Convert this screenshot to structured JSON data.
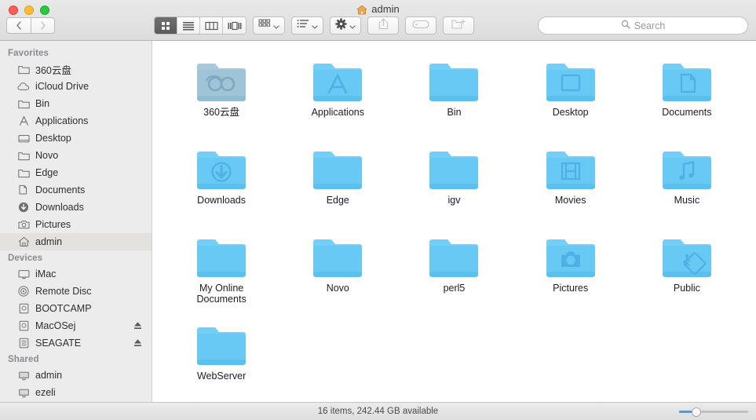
{
  "window": {
    "title": "admin",
    "title_icon": "home-icon",
    "traffic_lights": [
      {
        "name": "close-button",
        "color": "#ff5f57"
      },
      {
        "name": "minimize-button",
        "color": "#ffbd2e"
      },
      {
        "name": "maximize-button",
        "color": "#28c940"
      }
    ]
  },
  "nav": {
    "back_label": "Back",
    "forward_label": "Forward"
  },
  "toolbar": {
    "view_modes": [
      {
        "id": "icon-view",
        "label": "Icon View",
        "icon": "grid-icon",
        "active": true
      },
      {
        "id": "list-view",
        "label": "List View",
        "icon": "list-icon",
        "active": false
      },
      {
        "id": "column-view",
        "label": "Column View",
        "icon": "columns-icon",
        "active": false
      },
      {
        "id": "gallery-view",
        "label": "Gallery View",
        "icon": "gallery-icon",
        "active": false
      }
    ],
    "buttons": [
      {
        "id": "arrange",
        "label": "Arrange",
        "icon": "grid-arrange-icon",
        "has_chevron": true,
        "enabled": true
      },
      {
        "id": "group",
        "label": "Group",
        "icon": "list-bullets-icon",
        "has_chevron": true,
        "enabled": true
      },
      {
        "id": "action",
        "label": "Action",
        "icon": "gear-icon",
        "has_chevron": true,
        "enabled": true
      },
      {
        "id": "share",
        "label": "Share",
        "icon": "share-icon",
        "has_chevron": false,
        "enabled": false
      },
      {
        "id": "tags",
        "label": "Tags",
        "icon": "tag-icon",
        "has_chevron": false,
        "enabled": false
      },
      {
        "id": "new-folder",
        "label": "New Folder",
        "icon": "new-folder-icon",
        "has_chevron": false,
        "enabled": false
      }
    ]
  },
  "search": {
    "placeholder": "Search",
    "value": "",
    "icon": "search-icon"
  },
  "sidebar": {
    "sections": [
      {
        "title": "Favorites",
        "items": [
          {
            "label": "360云盘",
            "icon": "folder-icon",
            "selected": false,
            "ejectable": false
          },
          {
            "label": "iCloud Drive",
            "icon": "cloud-icon",
            "selected": false,
            "ejectable": false
          },
          {
            "label": "Bin",
            "icon": "folder-icon",
            "selected": false,
            "ejectable": false
          },
          {
            "label": "Applications",
            "icon": "applications-icon",
            "selected": false,
            "ejectable": false
          },
          {
            "label": "Desktop",
            "icon": "desktop-icon",
            "selected": false,
            "ejectable": false
          },
          {
            "label": "Novo",
            "icon": "folder-icon",
            "selected": false,
            "ejectable": false
          },
          {
            "label": "Edge",
            "icon": "folder-icon",
            "selected": false,
            "ejectable": false
          },
          {
            "label": "Documents",
            "icon": "documents-icon",
            "selected": false,
            "ejectable": false
          },
          {
            "label": "Downloads",
            "icon": "downloads-icon",
            "selected": false,
            "ejectable": false
          },
          {
            "label": "Pictures",
            "icon": "camera-icon",
            "selected": false,
            "ejectable": false
          },
          {
            "label": "admin",
            "icon": "home-icon",
            "selected": true,
            "ejectable": false
          }
        ]
      },
      {
        "title": "Devices",
        "items": [
          {
            "label": "iMac",
            "icon": "imac-icon",
            "selected": false,
            "ejectable": false
          },
          {
            "label": "Remote Disc",
            "icon": "remote-disc-icon",
            "selected": false,
            "ejectable": false
          },
          {
            "label": "BOOTCAMP",
            "icon": "hard-disk-icon",
            "selected": false,
            "ejectable": false
          },
          {
            "label": "MacOSej",
            "icon": "hard-disk-icon",
            "selected": false,
            "ejectable": true
          },
          {
            "label": "SEAGATE",
            "icon": "hard-disk-icon",
            "selected": false,
            "ejectable": true
          }
        ]
      },
      {
        "title": "Shared",
        "items": [
          {
            "label": "admin",
            "icon": "shared-computer-icon",
            "selected": false,
            "ejectable": false
          },
          {
            "label": "ezeli",
            "icon": "shared-computer-icon",
            "selected": false,
            "ejectable": false
          }
        ]
      }
    ]
  },
  "files": [
    {
      "name": "360云盘",
      "icon": "folder-cloud-icon",
      "tint": "#9fc4d8"
    },
    {
      "name": "Applications",
      "icon": "folder-app-icon",
      "tint": "#6ecbf5"
    },
    {
      "name": "Bin",
      "icon": "folder-plain-icon",
      "tint": "#6ecbf5"
    },
    {
      "name": "Desktop",
      "icon": "folder-desktop-icon",
      "tint": "#6ecbf5"
    },
    {
      "name": "Documents",
      "icon": "folder-documents-icon",
      "tint": "#6ecbf5"
    },
    {
      "name": "Downloads",
      "icon": "folder-downloads-icon",
      "tint": "#6ecbf5"
    },
    {
      "name": "Edge",
      "icon": "folder-plain-icon",
      "tint": "#6ecbf5"
    },
    {
      "name": "igv",
      "icon": "folder-plain-icon",
      "tint": "#6ecbf5"
    },
    {
      "name": "Movies",
      "icon": "folder-movies-icon",
      "tint": "#6ecbf5"
    },
    {
      "name": "Music",
      "icon": "folder-music-icon",
      "tint": "#6ecbf5"
    },
    {
      "name": "My Online Documents",
      "icon": "folder-plain-icon",
      "tint": "#6ecbf5"
    },
    {
      "name": "Novo",
      "icon": "folder-plain-icon",
      "tint": "#6ecbf5"
    },
    {
      "name": "perl5",
      "icon": "folder-plain-icon",
      "tint": "#6ecbf5"
    },
    {
      "name": "Pictures",
      "icon": "folder-pictures-icon",
      "tint": "#6ecbf5"
    },
    {
      "name": "Public",
      "icon": "folder-public-icon",
      "tint": "#6ecbf5"
    },
    {
      "name": "WebServer",
      "icon": "folder-plain-icon",
      "tint": "#6ecbf5"
    }
  ],
  "statusbar": {
    "text": "16 items, 242.44 GB available",
    "zoom_slider": {
      "label": "Icon Size",
      "value": 25
    }
  }
}
